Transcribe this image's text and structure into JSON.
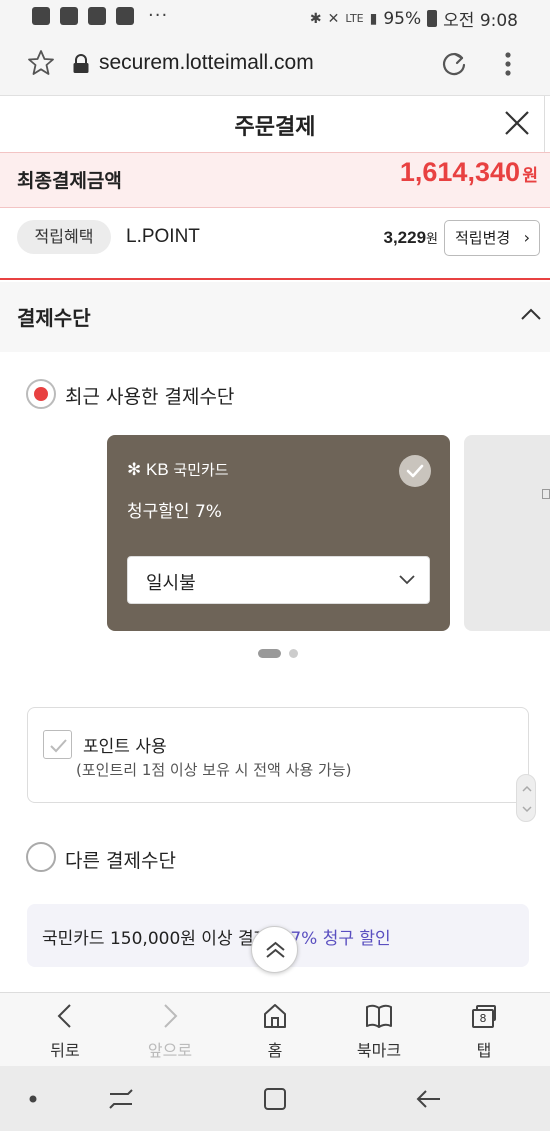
{
  "status_bar": {
    "battery": "95%",
    "time": "오전 9:08",
    "network": "LTE",
    "more": "···"
  },
  "browser": {
    "url": "securem.lotteimall.com"
  },
  "page": {
    "title": "주문결제"
  },
  "final_amount": {
    "label": "최종결제금액",
    "amount": "1,614,340",
    "unit": "원"
  },
  "reward": {
    "badge": "적립혜택",
    "program": "L.POINT",
    "points": "3,229",
    "unit": "원",
    "change_label": "적립변경",
    "change_chevron": "›"
  },
  "payment": {
    "section_title": "결제수단",
    "recent_label": "최근 사용한 결제수단",
    "card": {
      "brand": "KB",
      "name": "국민카드",
      "benefit": "청구할인 7%",
      "installment": "일시불",
      "selected": true
    },
    "carousel": {
      "page": 1,
      "total": 2
    },
    "point_use": {
      "label": "포인트 사용",
      "note": "(포인트리 1점 이상 보유 시 전액 사용 가능)",
      "checked": false
    },
    "other_label": "다른 결제수단",
    "promo": {
      "text": "국민카드 150,000원 이상 결제시",
      "highlight": "7% 청구 할인"
    }
  },
  "toolbar": {
    "back": "뒤로",
    "forward": "앞으로",
    "home": "홈",
    "bookmarks": "북마크",
    "tabs": "탭",
    "tab_count": "8"
  },
  "colors": {
    "accent": "#e84141",
    "card_bg": "#6e6458",
    "promo_highlight": "#5a4fc0"
  }
}
